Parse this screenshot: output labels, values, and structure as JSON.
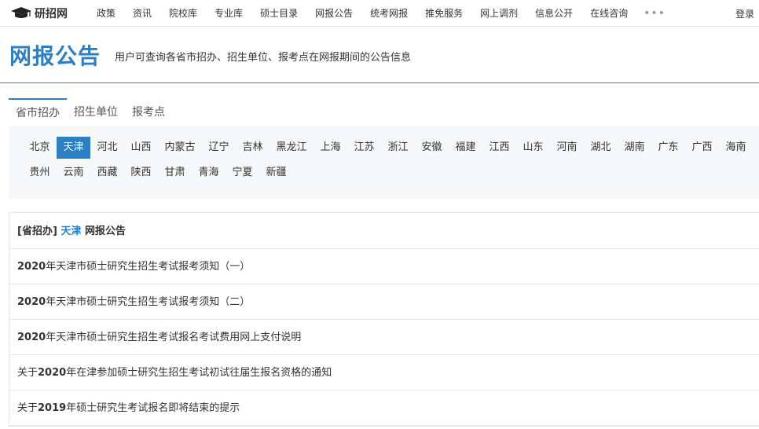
{
  "site": {
    "name": "研招网"
  },
  "nav": {
    "items": [
      "政策",
      "资讯",
      "院校库",
      "专业库",
      "硕士目录",
      "网报公告",
      "统考网报",
      "推免服务",
      "网上调剂",
      "信息公开",
      "在线咨询"
    ],
    "more": "•••",
    "login": "登录"
  },
  "header": {
    "title": "网报公告",
    "subtitle": "用户可查询各省市招办、招生单位、报考点在网报期间的公告信息"
  },
  "tabs": [
    "省市招办",
    "招生单位",
    "报考点"
  ],
  "regions": {
    "row1": [
      "北京",
      "天津",
      "河北",
      "山西",
      "内蒙古",
      "辽宁",
      "吉林",
      "黑龙江",
      "上海",
      "江苏",
      "浙江",
      "安徽",
      "福建",
      "江西",
      "山东",
      "河南",
      "湖北",
      "湖南",
      "广东",
      "广西",
      "海南"
    ],
    "row2": [
      "贵州",
      "云南",
      "西藏",
      "陕西",
      "甘肃",
      "青海",
      "宁夏",
      "新疆"
    ],
    "selected": "天津"
  },
  "list": {
    "head_prefix": "[省招办]",
    "head_city": "天津",
    "head_suffix": "网报公告",
    "items": [
      {
        "pre": "",
        "num": "2020",
        "rest": "年天津市硕士研究生招生考试报考须知（一）"
      },
      {
        "pre": "",
        "num": "2020",
        "rest": "年天津市硕士研究生招生考试报考须知（二）"
      },
      {
        "pre": "",
        "num": "2020",
        "rest": "年天津市硕士研究生招生考试报名考试费用网上支付说明"
      },
      {
        "pre": "关于",
        "num": "2020",
        "rest": "年在津参加硕士研究生招生考试初试往届生报名资格的通知"
      },
      {
        "pre": "关于",
        "num": "2019",
        "rest": "年硕士研究生考试报名即将结束的提示"
      }
    ]
  },
  "colors": {
    "accent": "#2d7fc1"
  }
}
